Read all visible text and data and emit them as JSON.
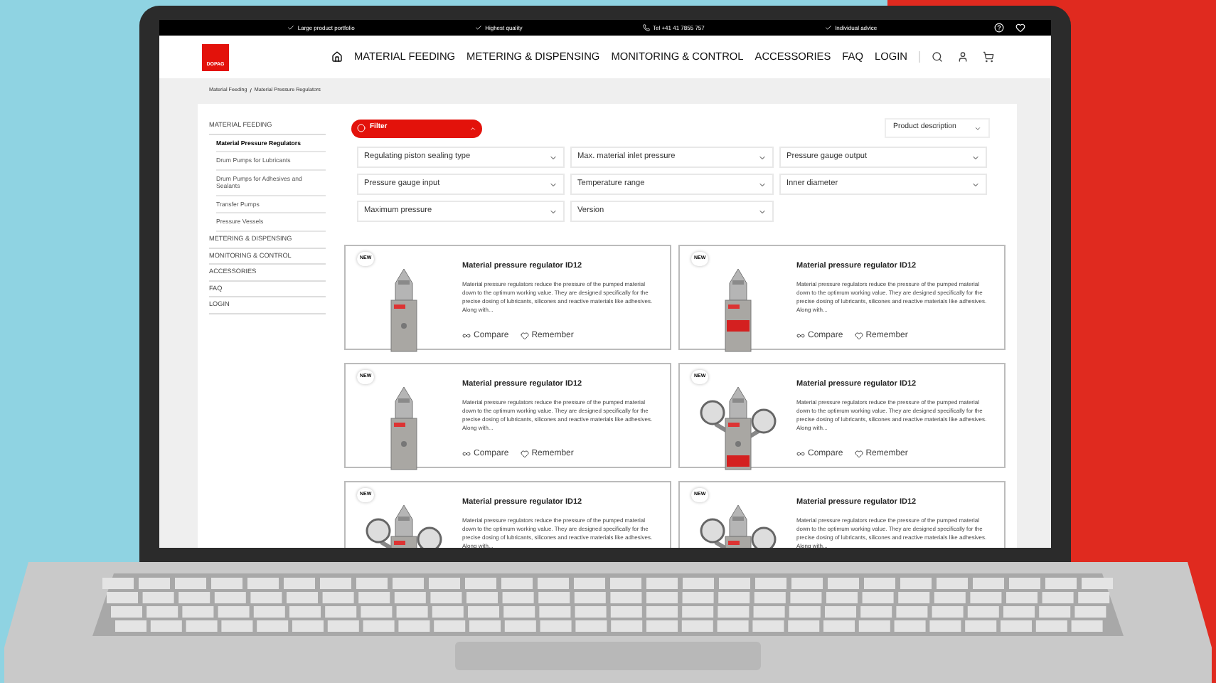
{
  "top_bar": {
    "items": [
      {
        "kind": "check",
        "label": "Large product portfolio"
      },
      {
        "kind": "check",
        "label": "Highest quality"
      },
      {
        "kind": "phone",
        "label": "Tel +41 41 7855 757"
      },
      {
        "kind": "check",
        "label": "Individual advice"
      }
    ]
  },
  "header": {
    "logo": "DOPAG",
    "nav": [
      "MATERIAL FEEDING",
      "METERING & DISPENSING",
      "MONITORING & CONTROL",
      "ACCESSORIES",
      "FAQ",
      "LOGIN"
    ]
  },
  "breadcrumb": {
    "items": [
      "Material Feeding",
      "Material Pressure Regulators"
    ],
    "separator": "/"
  },
  "sidebar": {
    "items": [
      {
        "label": "MATERIAL FEEDING",
        "selected": false,
        "children": [
          {
            "label": "Material Pressure Regulators",
            "selected": true
          },
          {
            "label": "Drum Pumps for Lubricants",
            "selected": false
          },
          {
            "label": "Drum Pumps for Adhesives and Sealants",
            "selected": false
          },
          {
            "label": "Transfer Pumps",
            "selected": false
          },
          {
            "label": "Pressure Vessels",
            "selected": false
          }
        ]
      },
      {
        "label": "METERING & DISPENSING",
        "selected": false
      },
      {
        "label": "MONITORING & CONTROL",
        "selected": false
      },
      {
        "label": "ACCESSORIES",
        "selected": false
      },
      {
        "label": "FAQ",
        "selected": false
      },
      {
        "label": "LOGIN",
        "selected": false
      }
    ]
  },
  "filter": {
    "label": "Filter",
    "expanded": true,
    "options": [
      "Regulating piston sealing type",
      "Max. material inlet pressure",
      "Pressure gauge output",
      "Pressure gauge input",
      "Temperature range",
      "Inner diameter",
      "Maximum pressure",
      "Version"
    ]
  },
  "sort": {
    "value": "Product description"
  },
  "products": [
    {
      "badge": "NEW",
      "title": "Material pressure regulator ID12",
      "description": "Material pressure regulators reduce the pressure of the pumped material down to the optimum working value. They are designed specifically for the precise dosing of lubricants, silicones and reactive materials like adhesives. Along with...",
      "compare": "Compare",
      "remember": "Remember"
    },
    {
      "badge": "NEW",
      "title": "Material pressure regulator ID12",
      "description": "Material pressure regulators reduce the pressure of the pumped material down to the optimum working value. They are designed specifically for the precise dosing of lubricants, silicones and reactive materials like adhesives. Along with...",
      "compare": "Compare",
      "remember": "Remember"
    },
    {
      "badge": "NEW",
      "title": "Material pressure regulator ID12",
      "description": "Material pressure regulators reduce the pressure of the pumped material down to the optimum working value. They are designed specifically for the precise dosing of lubricants, silicones and reactive materials like adhesives. Along with...",
      "compare": "Compare",
      "remember": "Remember"
    },
    {
      "badge": "NEW",
      "title": "Material pressure regulator ID12",
      "description": "Material pressure regulators reduce the pressure of the pumped material down to the optimum working value. They are designed specifically for the precise dosing of lubricants, silicones and reactive materials like adhesives. Along with...",
      "compare": "Compare",
      "remember": "Remember"
    },
    {
      "badge": "NEW",
      "title": "Material pressure regulator ID12",
      "description": "Material pressure regulators reduce the pressure of the pumped material down to the optimum working value. They are designed specifically for the precise dosing of lubricants, silicones and reactive materials like adhesives. Along with..."
    },
    {
      "badge": "NEW",
      "title": "Material pressure regulator ID12",
      "description": "Material pressure regulators reduce the pressure of the pumped material down to the optimum working value. They are designed specifically for the precise dosing of lubricants, silicones and reactive materials like adhesives. Along with..."
    }
  ]
}
